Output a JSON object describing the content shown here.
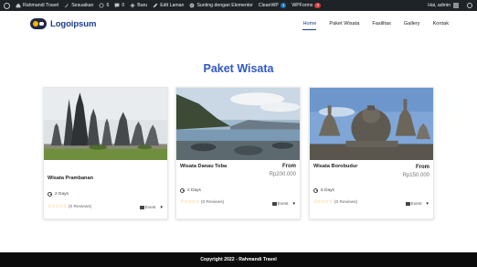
{
  "admin_bar": {
    "site_name": "Rahmandi Travel",
    "customize": "Sesuaikan",
    "updates_count": "6",
    "comments_count": "0",
    "new": "Baru",
    "edit_page": "Edit Laman",
    "elementor": "Sunting dengan Elementor",
    "cleantalk": "CleanWP",
    "cleantalk_badge": "1",
    "wpforms": "WPForms",
    "wpforms_badge": "3",
    "greeting": "Hai, admin"
  },
  "header": {
    "logo_text": "Logoipsum",
    "nav": [
      {
        "label": "Home",
        "active": true
      },
      {
        "label": "Paket Wisata",
        "active": false
      },
      {
        "label": "Fasilitas",
        "active": false
      },
      {
        "label": "Gallery",
        "active": false
      },
      {
        "label": "Kontak",
        "active": false
      }
    ]
  },
  "section_title": "Paket Wisata",
  "cards": [
    {
      "title": "Wisata Prambanan",
      "from": "",
      "price": "",
      "duration": "2 Days",
      "reviews": "(0 Reviews)",
      "stars": "☆☆☆☆☆",
      "category": "Event",
      "image": "prambanan-temple"
    },
    {
      "title": "Wisata Danau Toba",
      "from": "From",
      "price": "Rp200.000",
      "duration": "2 Days",
      "reviews": "(0 Reviews)",
      "stars": "☆☆☆☆☆",
      "category": "Event",
      "image": "lake-toba"
    },
    {
      "title": "Wisata Borobudur",
      "from": "From",
      "price": "Rp150.000",
      "duration": "5 Days",
      "reviews": "(0 Reviews)",
      "stars": "☆☆☆☆☆",
      "category": "Event",
      "image": "borobudur-stupa"
    }
  ],
  "footer": {
    "copyright": "Copyright 2022 - Rahmandi Travel"
  }
}
